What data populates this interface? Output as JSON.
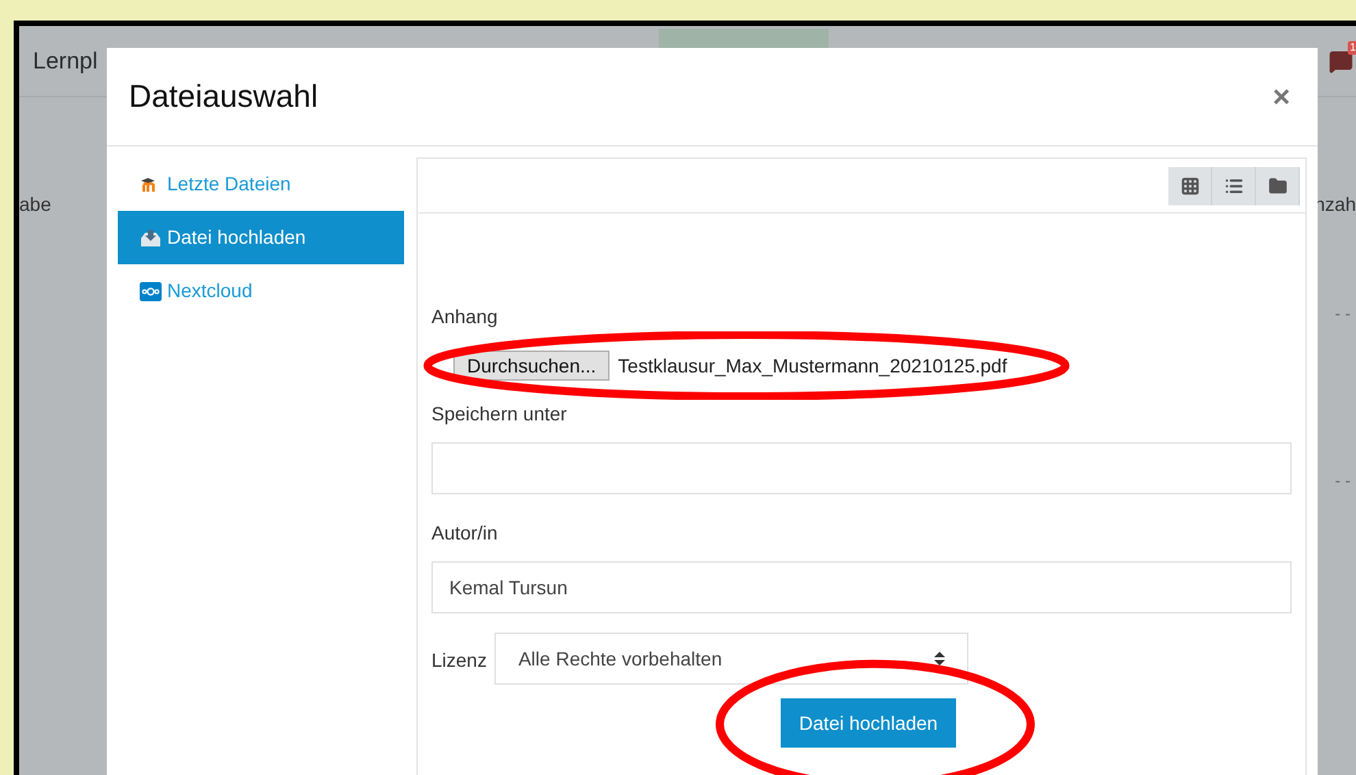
{
  "background": {
    "header_text": "Lernpl",
    "left_text": "abe",
    "right_text": "nzah",
    "notification_count": "1",
    "dash_rows": [
      "- -",
      "- -"
    ]
  },
  "dialog": {
    "title": "Dateiauswahl",
    "close": "×",
    "sources": [
      {
        "label": "Letzte Dateien",
        "kind": "recent",
        "selected": false
      },
      {
        "label": "Datei hochladen",
        "kind": "upload",
        "selected": true
      },
      {
        "label": "Nextcloud",
        "kind": "nextcloud",
        "selected": false
      }
    ],
    "view_buttons": [
      {
        "kind": "grid",
        "selected": false
      },
      {
        "kind": "list",
        "selected": false
      },
      {
        "kind": "folder",
        "selected": false
      }
    ],
    "form": {
      "attachment": {
        "label": "Anhang",
        "button": "Durchsuchen...",
        "filename": "Testklausur_Max_Mustermann_20210125.pdf",
        "highlighted": true
      },
      "save_as": {
        "label": "Speichern unter"
      },
      "author": {
        "label": "Autor/in",
        "value": "Kemal Tursun"
      },
      "license": {
        "label": "Lizenz",
        "value": "Alle Rechte vorbehalten"
      },
      "submit": {
        "label": "Datei hochladen",
        "highlighted": true
      }
    }
  }
}
